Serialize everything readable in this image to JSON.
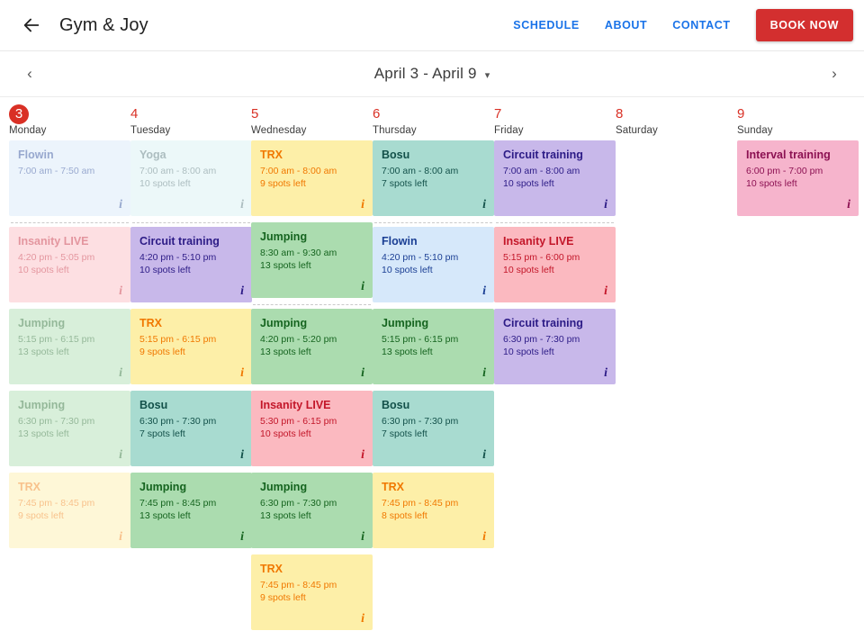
{
  "appbar": {
    "back_icon": "arrow-left-icon",
    "brand": "Gym & Joy",
    "nav": [
      {
        "label": "SCHEDULE"
      },
      {
        "label": "ABOUT"
      },
      {
        "label": "CONTACT"
      }
    ],
    "book_label": "BOOK NOW",
    "book_color": "#d32f2f",
    "link_color": "#1a73e8"
  },
  "weekbar": {
    "prev_icon": "chevron-left-icon",
    "next_icon": "chevron-right-icon",
    "range": "April 3 - April 9",
    "caret_icon": "chevron-down-icon"
  },
  "class_colors": {
    "Flowin": {
      "bg": "#d6e8fa",
      "fg": "#1b3f94"
    },
    "Yoga": {
      "bg": "#d6f0f2",
      "fg": "#4a6f75"
    },
    "TRX": {
      "bg": "#fdefa8",
      "fg": "#f07800"
    },
    "Bosu": {
      "bg": "#a8dbd0",
      "fg": "#13514a"
    },
    "Circuit training": {
      "bg": "#c8b8ea",
      "fg": "#2c1b86"
    },
    "Insanity LIVE": {
      "bg": "#fbb9c0",
      "fg": "#c31629"
    },
    "Jumping": {
      "bg": "#abdcaf",
      "fg": "#15641f"
    },
    "Interval training": {
      "bg": "#f6b4cc",
      "fg": "#8c1152"
    }
  },
  "info_icon_label": "info-icon",
  "today_badge_color": "#d93025",
  "days": [
    {
      "num": "3",
      "name": "Monday",
      "today": true,
      "divider_after": 1,
      "classes": [
        {
          "title": "Flowin",
          "time": "7:00 am - 7:50 am",
          "spots": "",
          "faded": true
        },
        {
          "title": "Insanity LIVE",
          "time": "4:20 pm - 5:05 pm",
          "spots": "10 spots left",
          "faded": true
        },
        {
          "title": "Jumping",
          "time": "5:15 pm - 6:15 pm",
          "spots": "13 spots left",
          "faded": true
        },
        {
          "title": "Jumping",
          "time": "6:30 pm - 7:30 pm",
          "spots": "13 spots left",
          "faded": true
        },
        {
          "title": "TRX",
          "time": "7:45 pm - 8:45 pm",
          "spots": "9 spots left",
          "faded": true
        }
      ]
    },
    {
      "num": "4",
      "name": "Tuesday",
      "today": false,
      "divider_after": 1,
      "classes": [
        {
          "title": "Yoga",
          "time": "7:00 am - 8:00 am",
          "spots": "10 spots left",
          "faded": true
        },
        {
          "title": "Circuit training",
          "time": "4:20 pm - 5:10 pm",
          "spots": "10 spots left",
          "faded": false
        },
        {
          "title": "TRX",
          "time": "5:15 pm - 6:15 pm",
          "spots": "9 spots left",
          "faded": false
        },
        {
          "title": "Bosu",
          "time": "6:30 pm - 7:30 pm",
          "spots": "7 spots left",
          "faded": false
        },
        {
          "title": "Jumping",
          "time": "7:45 pm - 8:45 pm",
          "spots": "13 spots left",
          "faded": false
        }
      ]
    },
    {
      "num": "5",
      "name": "Wednesday",
      "today": false,
      "divider_after": 2,
      "classes": [
        {
          "title": "TRX",
          "time": "7:00 am - 8:00 am",
          "spots": "9 spots left",
          "faded": false
        },
        {
          "title": "Jumping",
          "time": "8:30 am - 9:30 am",
          "spots": "13 spots left",
          "faded": false
        },
        {
          "title": "Jumping",
          "time": "4:20 pm - 5:20 pm",
          "spots": "13 spots left",
          "faded": false
        },
        {
          "title": "Insanity LIVE",
          "time": "5:30 pm - 6:15 pm",
          "spots": "10 spots left",
          "faded": false
        },
        {
          "title": "Jumping",
          "time": "6:30 pm - 7:30 pm",
          "spots": "13 spots left",
          "faded": false
        },
        {
          "title": "TRX",
          "time": "7:45 pm - 8:45 pm",
          "spots": "9 spots left",
          "faded": false
        }
      ]
    },
    {
      "num": "6",
      "name": "Thursday",
      "today": false,
      "divider_after": 1,
      "classes": [
        {
          "title": "Bosu",
          "time": "7:00 am - 8:00 am",
          "spots": "7 spots left",
          "faded": false
        },
        {
          "title": "Flowin",
          "time": "4:20 pm - 5:10 pm",
          "spots": "10 spots left",
          "faded": false
        },
        {
          "title": "Jumping",
          "time": "5:15 pm - 6:15 pm",
          "spots": "13 spots left",
          "faded": false
        },
        {
          "title": "Bosu",
          "time": "6:30 pm - 7:30 pm",
          "spots": "7 spots left",
          "faded": false
        },
        {
          "title": "TRX",
          "time": "7:45 pm - 8:45 pm",
          "spots": "8 spots left",
          "faded": false
        }
      ]
    },
    {
      "num": "7",
      "name": "Friday",
      "today": false,
      "divider_after": 1,
      "classes": [
        {
          "title": "Circuit training",
          "time": "7:00 am - 8:00 am",
          "spots": "10 spots left",
          "faded": false
        },
        {
          "title": "Insanity LIVE",
          "time": "5:15 pm - 6:00 pm",
          "spots": "10 spots left",
          "faded": false
        },
        {
          "title": "Circuit training",
          "time": "6:30 pm - 7:30 pm",
          "spots": "10 spots left",
          "faded": false
        }
      ]
    },
    {
      "num": "8",
      "name": "Saturday",
      "today": false,
      "divider_after": -1,
      "classes": []
    },
    {
      "num": "9",
      "name": "Sunday",
      "today": false,
      "divider_after": -1,
      "classes": [
        {
          "title": "Interval training",
          "time": "6:00 pm - 7:00 pm",
          "spots": "10 spots left",
          "faded": false
        }
      ]
    }
  ]
}
